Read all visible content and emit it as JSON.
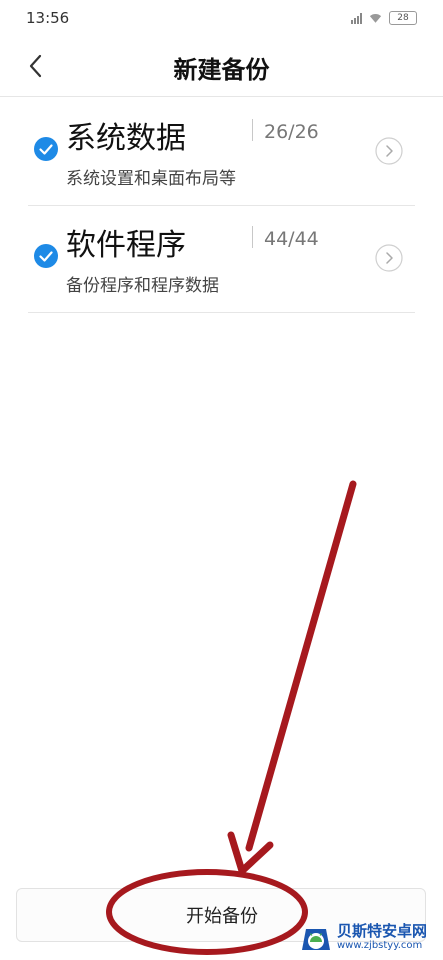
{
  "status_bar": {
    "time": "13:56",
    "battery": "28"
  },
  "header": {
    "title": "新建备份"
  },
  "items": [
    {
      "title": "系统数据",
      "count": "26/26",
      "subtitle": "系统设置和桌面布局等",
      "checked": true
    },
    {
      "title": "软件程序",
      "count": "44/44",
      "subtitle": "备份程序和程序数据",
      "checked": true
    }
  ],
  "bottom": {
    "start_label": "开始备份"
  },
  "colors": {
    "accent": "#1e8ae6",
    "annotation": "#a6191e"
  },
  "watermark": {
    "name": "贝斯特安卓网",
    "url": "www.zjbstyy.com"
  }
}
